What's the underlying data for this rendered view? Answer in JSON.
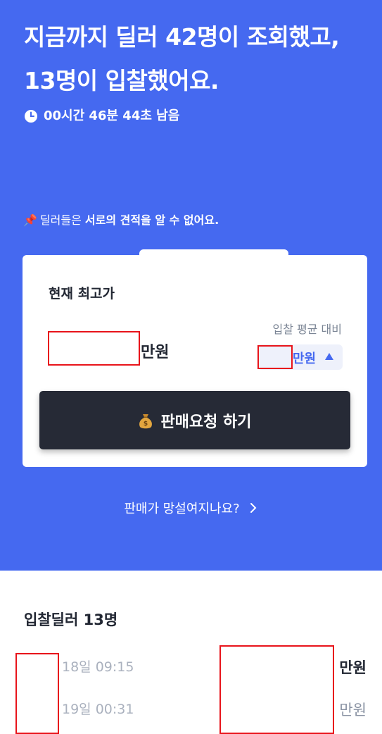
{
  "hero": {
    "headline_line1": "지금까지 딜러 42명이 조회했고,",
    "headline_line2": "13명이 입찰했어요.",
    "timer": "00시간 46분 44초 남음",
    "notice_prefix": "딜러들은 ",
    "notice_bold": "서로의 견적을 알 수 없어요.",
    "notice_icon": "pushpin-icon",
    "link": "판매가 망설여지나요?",
    "colors": {
      "background": "#4569F0",
      "text": "#FFFFFF"
    }
  },
  "card": {
    "label": "현재 최고가",
    "price_unit": "만원",
    "compare_label": "입찰 평균 대비",
    "compare_unit": "만원",
    "compare_icon": "triangle-up-icon",
    "button_label": "판매요청 하기",
    "button_icon": "money-bag-icon",
    "colors": {
      "button": "#262A36",
      "accent": "#4569F0"
    }
  },
  "bidders": {
    "title": "입찰딜러 13명",
    "rows": [
      {
        "time": "18일 09:15",
        "unit": "만원",
        "emphasis": true
      },
      {
        "time": "19일 00:31",
        "unit": "만원",
        "emphasis": false
      }
    ]
  }
}
